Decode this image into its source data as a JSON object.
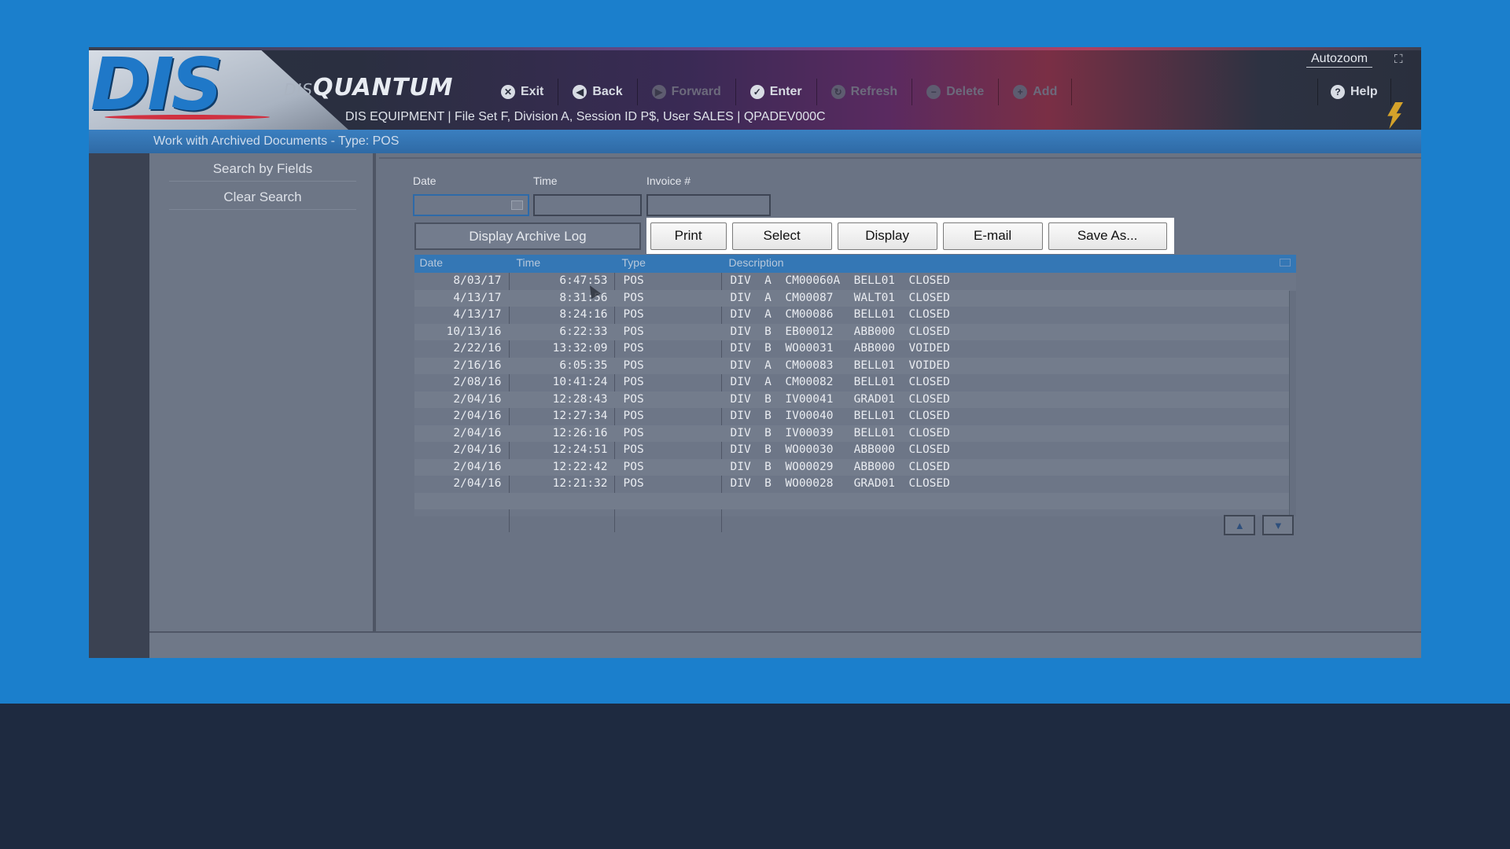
{
  "header": {
    "logo": "DIS",
    "brand_prefix": "DIS",
    "brand_name": "QUANTUM",
    "session_info": "DIS EQUIPMENT | File Set F, Division A, Session ID P$, User SALES | QPADEV000C",
    "autozoom": "Autozoom",
    "toolbar": [
      {
        "label": "Exit",
        "icon": "x-circle-icon",
        "enabled": true
      },
      {
        "label": "Back",
        "icon": "arrow-left-circle-icon",
        "enabled": true
      },
      {
        "label": "Forward",
        "icon": "arrow-right-circle-icon",
        "enabled": false
      },
      {
        "label": "Enter",
        "icon": "check-circle-icon",
        "enabled": true
      },
      {
        "label": "Refresh",
        "icon": "refresh-icon",
        "enabled": false
      },
      {
        "label": "Delete",
        "icon": "minus-circle-icon",
        "enabled": false
      },
      {
        "label": "Add",
        "icon": "plus-circle-icon",
        "enabled": false
      }
    ],
    "help": "Help"
  },
  "page_title": "Work with Archived Documents - Type: POS",
  "sidebar": {
    "items": [
      "Search by Fields",
      "Clear Search"
    ]
  },
  "filters": {
    "date_label": "Date",
    "time_label": "Time",
    "invoice_label": "Invoice #",
    "date_value": "",
    "time_value": "",
    "invoice_value": ""
  },
  "buttons": {
    "archive_log": "Display Archive Log",
    "print": "Print",
    "select": "Select",
    "display": "Display",
    "email": "E-mail",
    "save_as": "Save As..."
  },
  "table": {
    "columns": [
      "Date",
      "Time",
      "Type",
      "Description"
    ],
    "rows": [
      [
        "8/03/17",
        "6:47:53",
        "POS",
        "DIV  A  CM00060A  BELL01  CLOSED"
      ],
      [
        "4/13/17",
        "8:31:56",
        "POS",
        "DIV  A  CM00087   WALT01  CLOSED"
      ],
      [
        "4/13/17",
        "8:24:16",
        "POS",
        "DIV  A  CM00086   BELL01  CLOSED"
      ],
      [
        "10/13/16",
        "6:22:33",
        "POS",
        "DIV  B  EB00012   ABB000  CLOSED"
      ],
      [
        "2/22/16",
        "13:32:09",
        "POS",
        "DIV  B  WO00031   ABB000  VOIDED"
      ],
      [
        "2/16/16",
        "6:05:35",
        "POS",
        "DIV  A  CM00083   BELL01  VOIDED"
      ],
      [
        "2/08/16",
        "10:41:24",
        "POS",
        "DIV  A  CM00082   BELL01  CLOSED"
      ],
      [
        "2/04/16",
        "12:28:43",
        "POS",
        "DIV  B  IV00041   GRAD01  CLOSED"
      ],
      [
        "2/04/16",
        "12:27:34",
        "POS",
        "DIV  B  IV00040   BELL01  CLOSED"
      ],
      [
        "2/04/16",
        "12:26:16",
        "POS",
        "DIV  B  IV00039   BELL01  CLOSED"
      ],
      [
        "2/04/16",
        "12:24:51",
        "POS",
        "DIV  B  WO00030   ABB000  CLOSED"
      ],
      [
        "2/04/16",
        "12:22:42",
        "POS",
        "DIV  B  WO00029   ABB000  CLOSED"
      ],
      [
        "2/04/16",
        "12:21:32",
        "POS",
        "DIV  B  WO00028   GRAD01  CLOSED"
      ]
    ]
  },
  "colors": {
    "page_background": "#1b7fcc",
    "footer_band": "#1e2a40",
    "grid_header": "#3477b5",
    "accent_bolt": "#d4a22a"
  }
}
